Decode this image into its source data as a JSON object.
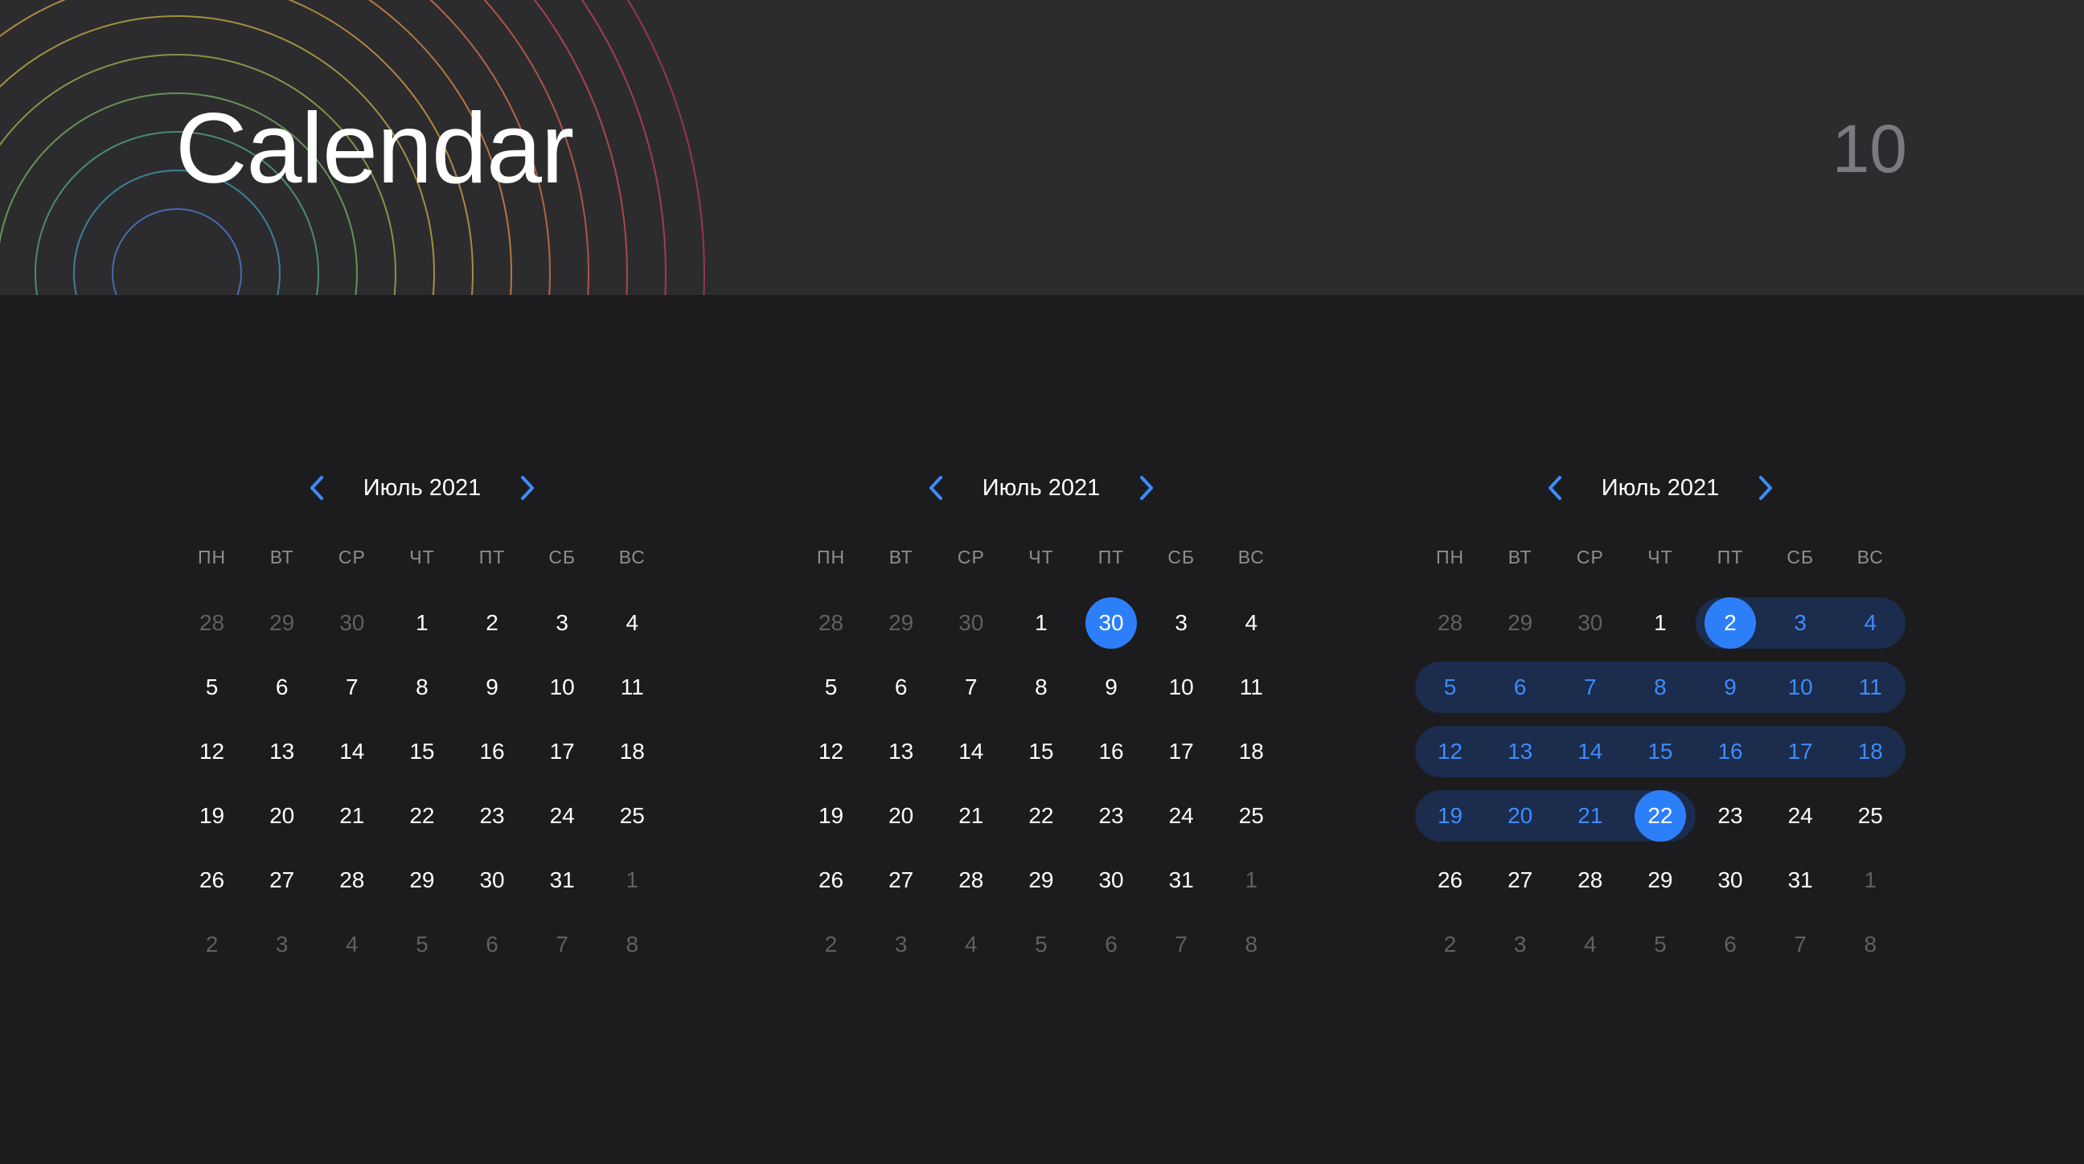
{
  "header": {
    "title": "Calendar",
    "page_number": "10"
  },
  "colors": {
    "accent": "#2d7ff9",
    "range_bg": "#1b2c4d",
    "range_text": "#3d8cff",
    "header_bg": "#2c2c2e",
    "page_bg": "#1c1c1e"
  },
  "icons": {
    "prev": "chevron-left-icon",
    "next": "chevron-right-icon"
  },
  "calendars": [
    {
      "month_label": "Июль 2021",
      "weekdays": [
        "ПН",
        "ВТ",
        "СР",
        "ЧТ",
        "ПТ",
        "СБ",
        "ВС"
      ],
      "days": [
        {
          "d": "28",
          "m": true
        },
        {
          "d": "29",
          "m": true
        },
        {
          "d": "30",
          "m": true
        },
        {
          "d": "1"
        },
        {
          "d": "2"
        },
        {
          "d": "3"
        },
        {
          "d": "4"
        },
        {
          "d": "5"
        },
        {
          "d": "6"
        },
        {
          "d": "7"
        },
        {
          "d": "8"
        },
        {
          "d": "9"
        },
        {
          "d": "10"
        },
        {
          "d": "11"
        },
        {
          "d": "12"
        },
        {
          "d": "13"
        },
        {
          "d": "14"
        },
        {
          "d": "15"
        },
        {
          "d": "16"
        },
        {
          "d": "17"
        },
        {
          "d": "18"
        },
        {
          "d": "19"
        },
        {
          "d": "20"
        },
        {
          "d": "21"
        },
        {
          "d": "22"
        },
        {
          "d": "23"
        },
        {
          "d": "24"
        },
        {
          "d": "25"
        },
        {
          "d": "26"
        },
        {
          "d": "27"
        },
        {
          "d": "28"
        },
        {
          "d": "29"
        },
        {
          "d": "30"
        },
        {
          "d": "31"
        },
        {
          "d": "1",
          "m": true
        },
        {
          "d": "2",
          "m": true
        },
        {
          "d": "3",
          "m": true
        },
        {
          "d": "4",
          "m": true
        },
        {
          "d": "5",
          "m": true
        },
        {
          "d": "6",
          "m": true
        },
        {
          "d": "7",
          "m": true
        },
        {
          "d": "8",
          "m": true
        }
      ]
    },
    {
      "month_label": "Июль 2021",
      "weekdays": [
        "ПН",
        "ВТ",
        "СР",
        "ЧТ",
        "ПТ",
        "СБ",
        "ВС"
      ],
      "days": [
        {
          "d": "28",
          "m": true
        },
        {
          "d": "29",
          "m": true
        },
        {
          "d": "30",
          "m": true
        },
        {
          "d": "1"
        },
        {
          "d": "30",
          "sel": true
        },
        {
          "d": "3"
        },
        {
          "d": "4"
        },
        {
          "d": "5"
        },
        {
          "d": "6"
        },
        {
          "d": "7"
        },
        {
          "d": "8"
        },
        {
          "d": "9"
        },
        {
          "d": "10"
        },
        {
          "d": "11"
        },
        {
          "d": "12"
        },
        {
          "d": "13"
        },
        {
          "d": "14"
        },
        {
          "d": "15"
        },
        {
          "d": "16"
        },
        {
          "d": "17"
        },
        {
          "d": "18"
        },
        {
          "d": "19"
        },
        {
          "d": "20"
        },
        {
          "d": "21"
        },
        {
          "d": "22"
        },
        {
          "d": "23"
        },
        {
          "d": "24"
        },
        {
          "d": "25"
        },
        {
          "d": "26"
        },
        {
          "d": "27"
        },
        {
          "d": "28"
        },
        {
          "d": "29"
        },
        {
          "d": "30"
        },
        {
          "d": "31"
        },
        {
          "d": "1",
          "m": true
        },
        {
          "d": "2",
          "m": true
        },
        {
          "d": "3",
          "m": true
        },
        {
          "d": "4",
          "m": true
        },
        {
          "d": "5",
          "m": true
        },
        {
          "d": "6",
          "m": true
        },
        {
          "d": "7",
          "m": true
        },
        {
          "d": "8",
          "m": true
        }
      ]
    },
    {
      "month_label": "Июль 2021",
      "weekdays": [
        "ПН",
        "ВТ",
        "СР",
        "ЧТ",
        "ПТ",
        "СБ",
        "ВС"
      ],
      "days": [
        {
          "d": "28",
          "m": true
        },
        {
          "d": "29",
          "m": true
        },
        {
          "d": "30",
          "m": true
        },
        {
          "d": "1"
        },
        {
          "d": "2",
          "sel": true,
          "r": true
        },
        {
          "d": "3",
          "r": true
        },
        {
          "d": "4",
          "r": true
        },
        {
          "d": "5",
          "r": true
        },
        {
          "d": "6",
          "r": true
        },
        {
          "d": "7",
          "r": true
        },
        {
          "d": "8",
          "r": true
        },
        {
          "d": "9",
          "r": true
        },
        {
          "d": "10",
          "r": true
        },
        {
          "d": "11",
          "r": true
        },
        {
          "d": "12",
          "r": true
        },
        {
          "d": "13",
          "r": true
        },
        {
          "d": "14",
          "r": true
        },
        {
          "d": "15",
          "r": true
        },
        {
          "d": "16",
          "r": true
        },
        {
          "d": "17",
          "r": true
        },
        {
          "d": "18",
          "r": true
        },
        {
          "d": "19",
          "r": true
        },
        {
          "d": "20",
          "r": true
        },
        {
          "d": "21",
          "r": true
        },
        {
          "d": "22",
          "sel": true,
          "r": true
        },
        {
          "d": "23"
        },
        {
          "d": "24"
        },
        {
          "d": "25"
        },
        {
          "d": "26"
        },
        {
          "d": "27"
        },
        {
          "d": "28"
        },
        {
          "d": "29"
        },
        {
          "d": "30"
        },
        {
          "d": "31"
        },
        {
          "d": "1",
          "m": true
        },
        {
          "d": "2",
          "m": true
        },
        {
          "d": "3",
          "m": true
        },
        {
          "d": "4",
          "m": true
        },
        {
          "d": "5",
          "m": true
        },
        {
          "d": "6",
          "m": true
        },
        {
          "d": "7",
          "m": true
        },
        {
          "d": "8",
          "m": true
        }
      ]
    }
  ]
}
